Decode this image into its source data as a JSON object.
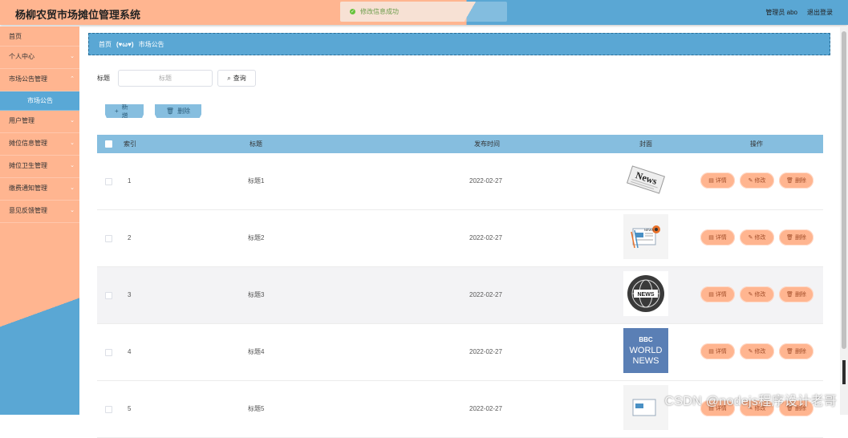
{
  "header": {
    "title": "杨柳农贸市场摊位管理系统",
    "toast": "修改信息成功",
    "user_label": "管理员 abo",
    "logout": "退出登录"
  },
  "sidebar": {
    "items": [
      {
        "label": "首页",
        "chevron": false
      },
      {
        "label": "个人中心",
        "chevron": true
      },
      {
        "label": "市场公告管理",
        "chevron": true
      },
      {
        "label": "市场公告",
        "sub": true
      },
      {
        "label": "用户管理",
        "chevron": true
      },
      {
        "label": "摊位信息管理",
        "chevron": true
      },
      {
        "label": "摊位卫生管理",
        "chevron": true
      },
      {
        "label": "缴费通知管理",
        "chevron": true
      },
      {
        "label": "意见反馈管理",
        "chevron": true
      }
    ]
  },
  "breadcrumb": {
    "home": "首页",
    "sep": "(♥ω♥)",
    "current": "市场公告"
  },
  "search": {
    "label": "标题",
    "placeholder": "标题",
    "button": "查询"
  },
  "toolbar": {
    "add": "新增",
    "delete": "删除"
  },
  "table": {
    "columns": [
      "索引",
      "标题",
      "发布时间",
      "封面",
      "操作"
    ],
    "rows": [
      {
        "index": "1",
        "title": "标题1",
        "date": "2022-02-27",
        "cover": "news-paper-icon"
      },
      {
        "index": "2",
        "title": "标题2",
        "date": "2022-02-27",
        "cover": "news-desk-icon"
      },
      {
        "index": "3",
        "title": "标题3",
        "date": "2022-02-27",
        "cover": "news-globe-icon"
      },
      {
        "index": "4",
        "title": "标题4",
        "date": "2022-02-27",
        "cover": "bbc-world-news-icon"
      },
      {
        "index": "5",
        "title": "标题5",
        "date": "2022-02-27",
        "cover": "news-desk-icon"
      }
    ],
    "ops": {
      "detail": "详情",
      "edit": "修改",
      "delete": "删除"
    }
  },
  "cover_text": {
    "news": "News",
    "news_small": "NEWS",
    "bbc": "BBC",
    "world": "WORLD",
    "news2": "NEWS"
  },
  "watermark": "CSDN @nodejs程序设计老哥",
  "colors": {
    "peach": "#ffb590",
    "blue": "#5aa7d4",
    "light_blue": "#86bedf"
  }
}
